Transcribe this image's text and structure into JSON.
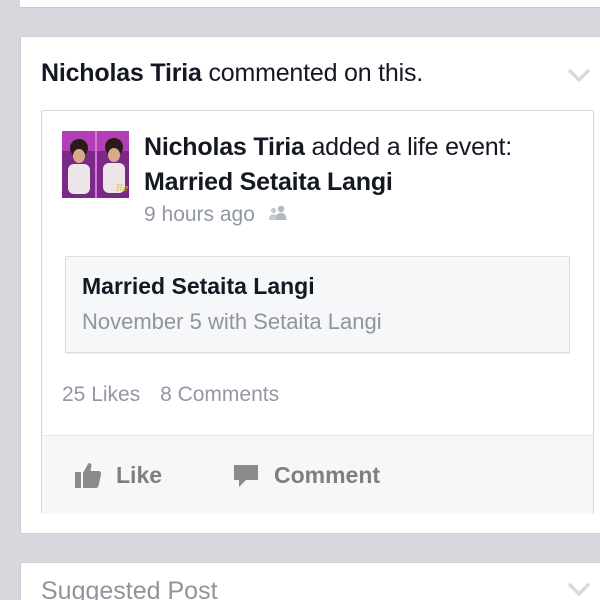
{
  "story": {
    "actor": "Nicholas Tiria",
    "action_text": "commented on this."
  },
  "post": {
    "actor": "Nicholas Tiria",
    "action_text": "added a life event:",
    "event_name": "Married Setaita Langi",
    "timestamp": "9 hours ago",
    "privacy_icon": "friends-icon",
    "avatar_icon": "profile-photo"
  },
  "life_event": {
    "title": "Married Setaita Langi",
    "subtitle": "November 5 with Setaita Langi"
  },
  "stats": {
    "likes": "25 Likes",
    "comments": "8 Comments"
  },
  "actions": {
    "like_label": "Like",
    "like_icon": "thumbs-up-icon",
    "comment_label": "Comment",
    "comment_icon": "speech-bubble-icon"
  },
  "next_card": {
    "header": "Suggested Post"
  },
  "colors": {
    "background": "#d6d8dd",
    "text_primary": "#141823",
    "text_secondary": "#9197a3",
    "action_gray": "#7f7f7f"
  }
}
